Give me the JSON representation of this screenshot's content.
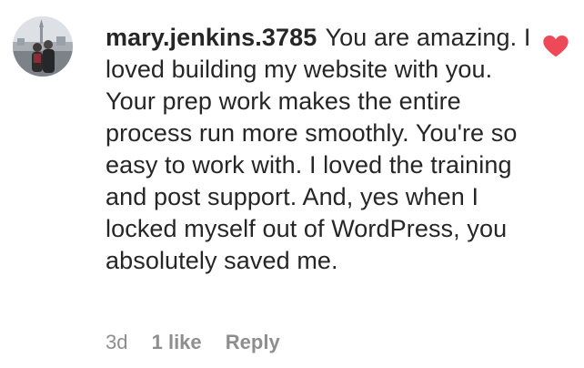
{
  "comment": {
    "username": "mary.jenkins.3785",
    "text": "You are amazing. I loved building my website with you. Your prep work makes the entire process run more smoothly. You're so easy to work with. I loved the training and post support. And, yes when I locked myself out of WordPress, you absolutely saved me.",
    "time": "3d",
    "likes": "1 like",
    "reply_label": "Reply"
  },
  "icons": {
    "like": "heart-icon",
    "avatar": "avatar"
  },
  "colors": {
    "heart": "#ed4956",
    "meta": "#8e8e8e",
    "text": "#262626"
  }
}
